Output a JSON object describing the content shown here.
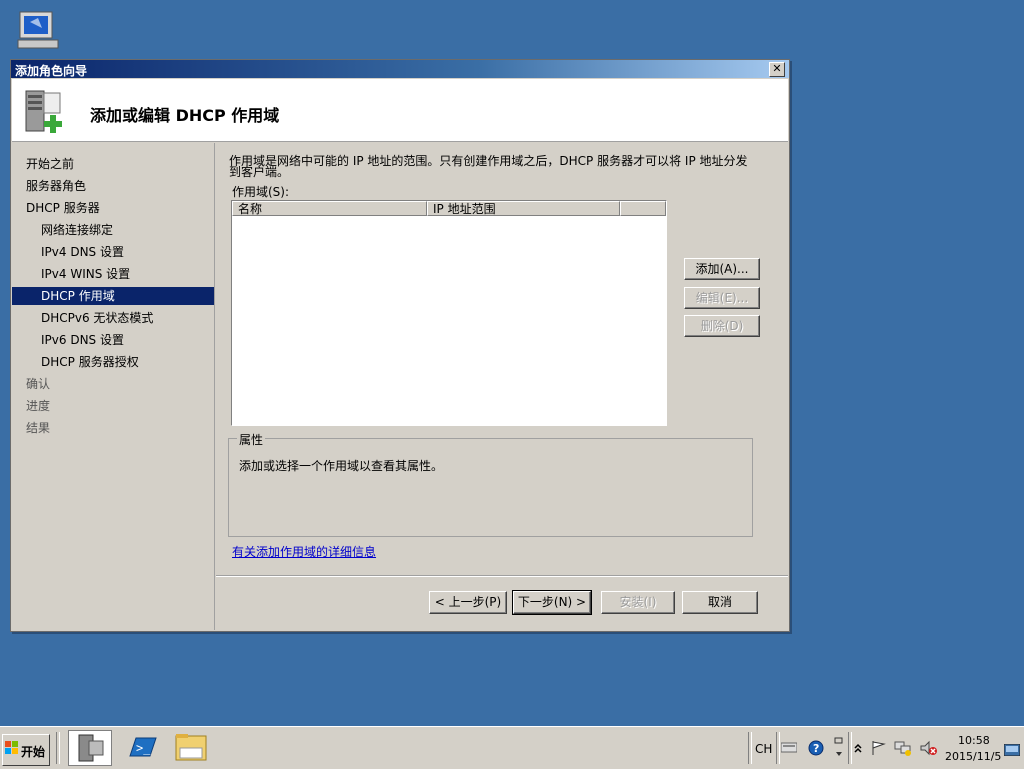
{
  "window": {
    "title": "添加角色向导",
    "close_label": "✕",
    "header_title": "添加或编辑 DHCP 作用域"
  },
  "nav": {
    "items": [
      {
        "label": "开始之前",
        "indent": 0,
        "active": false
      },
      {
        "label": "服务器角色",
        "indent": 0,
        "active": false
      },
      {
        "label": "DHCP 服务器",
        "indent": 0,
        "active": false
      },
      {
        "label": "网络连接绑定",
        "indent": 1,
        "active": false
      },
      {
        "label": "IPv4 DNS 设置",
        "indent": 1,
        "active": false
      },
      {
        "label": "IPv4 WINS 设置",
        "indent": 1,
        "active": false
      },
      {
        "label": "DHCP 作用域",
        "indent": 1,
        "active": true
      },
      {
        "label": "DHCPv6 无状态模式",
        "indent": 1,
        "active": false
      },
      {
        "label": "IPv6 DNS 设置",
        "indent": 1,
        "active": false
      },
      {
        "label": "DHCP 服务器授权",
        "indent": 1,
        "active": false
      },
      {
        "label": "确认",
        "indent": 0,
        "active": false
      },
      {
        "label": "进度",
        "indent": 0,
        "active": false
      },
      {
        "label": "结果",
        "indent": 0,
        "active": false
      }
    ]
  },
  "content": {
    "description": "作用域是网络中可能的 IP 地址的范围。只有创建作用域之后，DHCP 服务器才可以将 IP 地址分发到客户端。",
    "scopes_label": "作用域(S):",
    "columns": [
      "名称",
      "IP 地址范围"
    ],
    "buttons": {
      "add": "添加(A)...",
      "edit": "编辑(E)...",
      "delete": "删除(D)"
    },
    "properties_legend": "属性",
    "properties_text": "添加或选择一个作用域以查看其属性。",
    "more_info_link": "有关添加作用域的详细信息"
  },
  "footer": {
    "back": "< 上一步(P)",
    "next": "下一步(N) >",
    "install": "安装(I)",
    "cancel": "取消"
  },
  "taskbar": {
    "start_label": "开始",
    "lang": "CH",
    "time": "10:58",
    "date": "2015/11/5"
  }
}
